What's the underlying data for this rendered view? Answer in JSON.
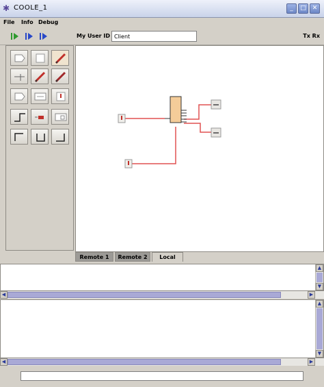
{
  "window": {
    "title": "COOLE_1",
    "minimize_icon": "minimize-icon",
    "maximize_icon": "maximize-icon",
    "close_icon": "close-icon"
  },
  "menu": {
    "items": [
      "File",
      "Info",
      "Debug"
    ]
  },
  "toolbar": {
    "buttons": [
      "run-icon",
      "step-icon",
      "step-forward-icon"
    ],
    "user_id_label": "My User ID :",
    "user_id_value": "Client",
    "txrx": "Tx Rx"
  },
  "tabs": [
    {
      "label": "Remote 1",
      "active": false
    },
    {
      "label": "Remote 2",
      "active": false
    },
    {
      "label": "Local",
      "active": true
    }
  ],
  "colors": {
    "wire": "#e05050",
    "component_fill": "#f4cc99",
    "scroll_thumb": "#a9a9d6"
  }
}
